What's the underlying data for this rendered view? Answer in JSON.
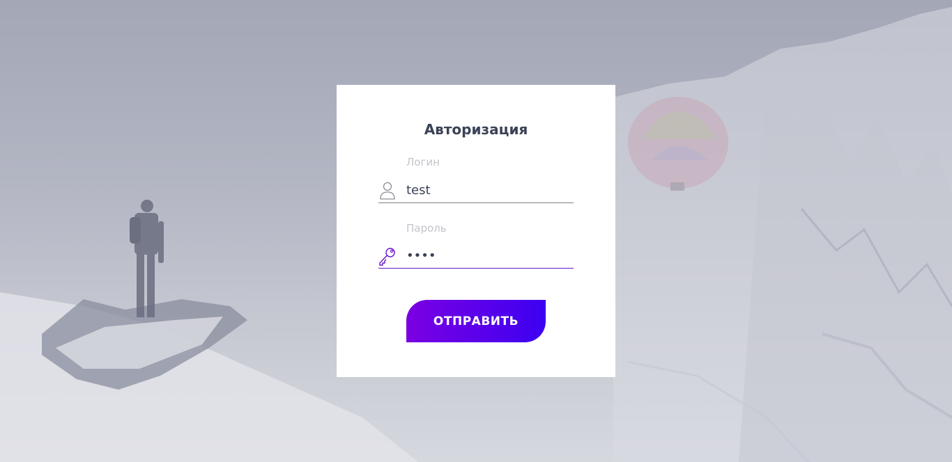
{
  "login_form": {
    "title": "Авторизация",
    "login_label": "Логин",
    "login_value": "test",
    "login_icon": "user-icon",
    "password_label": "Пароль",
    "password_value": "test",
    "password_icon": "key-icon",
    "submit_label": "ОТПРАВИТЬ"
  },
  "colors": {
    "accent_start": "#7b00e2",
    "accent_end": "#3d00f2",
    "title_text": "#3b4256",
    "label_text": "#c3c4cb"
  }
}
